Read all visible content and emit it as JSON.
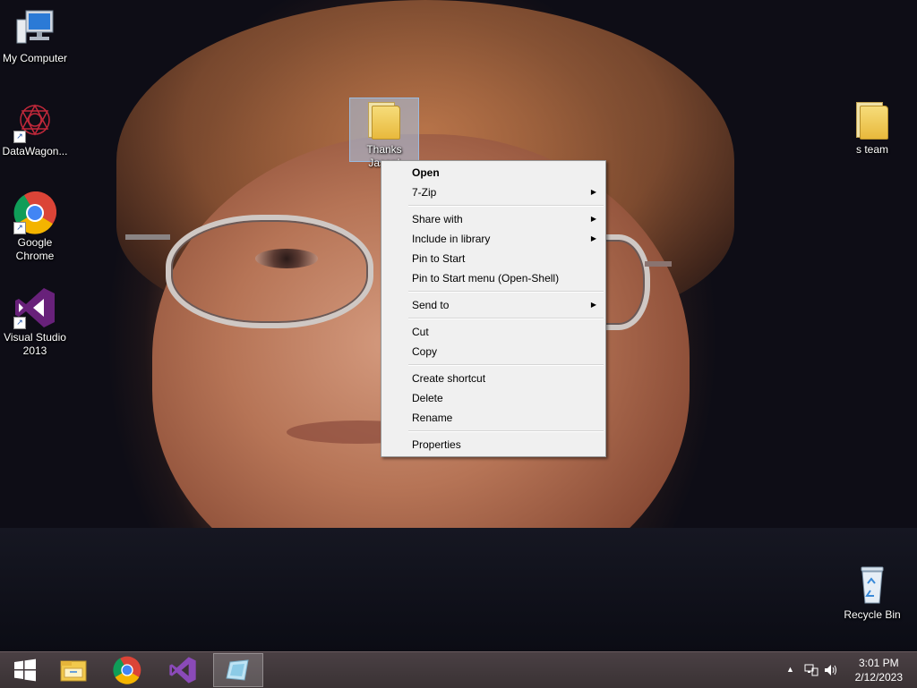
{
  "desktop": {
    "icons": [
      {
        "label": "My Computer",
        "icon": "computer-icon"
      },
      {
        "label": "DataWagon...",
        "icon": "datawagon-icon"
      },
      {
        "label": "Google Chrome",
        "icon": "chrome-icon"
      },
      {
        "label": "Visual Studio 2013",
        "icon": "visual-studio-icon"
      },
      {
        "label": "Thanks Jason!",
        "icon": "folder-icon"
      },
      {
        "label": "s team",
        "icon": "folder-icon"
      },
      {
        "label": "Recycle Bin",
        "icon": "recycle-bin-icon"
      }
    ]
  },
  "context_menu": {
    "items": [
      {
        "label": "Open"
      },
      {
        "label": "7-Zip"
      },
      {
        "label": "Share with"
      },
      {
        "label": "Include in library"
      },
      {
        "label": "Pin to Start"
      },
      {
        "label": "Pin to Start menu (Open-Shell)"
      },
      {
        "label": "Send to"
      },
      {
        "label": "Cut"
      },
      {
        "label": "Copy"
      },
      {
        "label": "Create shortcut"
      },
      {
        "label": "Delete"
      },
      {
        "label": "Rename"
      },
      {
        "label": "Properties"
      }
    ]
  },
  "taskbar": {
    "buttons": [
      "start-icon",
      "file-explorer-icon",
      "chrome-icon",
      "visual-studio-icon",
      "paint-icon"
    ],
    "tray": {
      "time": "3:01 PM",
      "date": "2/12/2023",
      "icons": [
        "show-hidden-icons-icon",
        "network-icon",
        "volume-icon"
      ]
    }
  }
}
